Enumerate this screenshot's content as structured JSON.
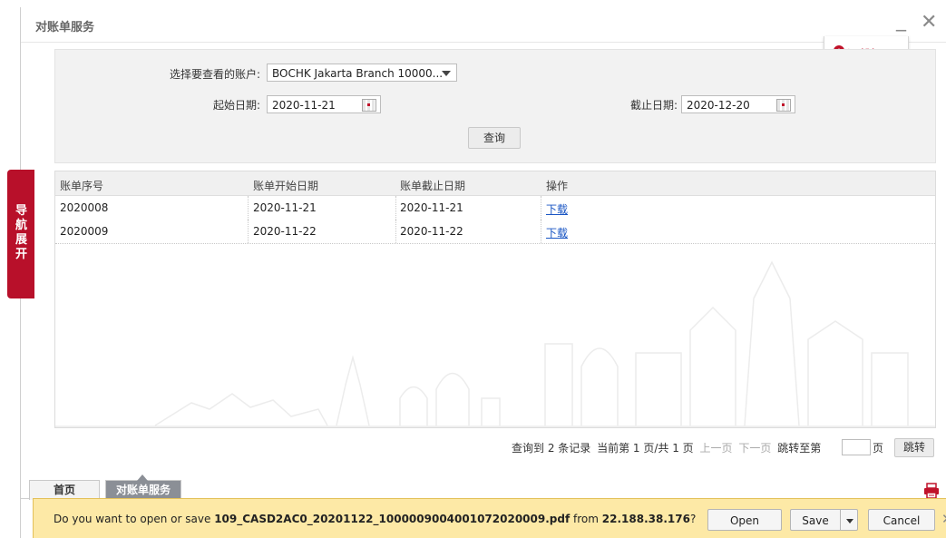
{
  "window": {
    "title": "对账单服务"
  },
  "tips": {
    "label": "温馨提示"
  },
  "nav_tab": {
    "label": "导航展开"
  },
  "query": {
    "account_label": "选择要查看的账户:",
    "account_value": "BOCHK Jakarta Branch 10000...",
    "start_label": "起始日期:",
    "start_value": "2020-11-21",
    "end_label": "截止日期:",
    "end_value": "2020-12-20",
    "search_button": "查询"
  },
  "table": {
    "headers": [
      "账单序号",
      "账单开始日期",
      "账单截止日期",
      "操作"
    ],
    "rows": [
      {
        "id": "2020008",
        "start": "2020-11-21",
        "end": "2020-11-21",
        "action": "下载"
      },
      {
        "id": "2020009",
        "start": "2020-11-22",
        "end": "2020-11-22",
        "action": "下载"
      }
    ]
  },
  "pager": {
    "summary": "查询到 2 条记录",
    "current": "当前第 1 页/共 1 页",
    "prev": "上一页",
    "next": "下一页",
    "jump_label": "跳转至第",
    "page_unit": "页",
    "jump_button": "跳转"
  },
  "tabs": {
    "home": "首页",
    "active": "对账单服务"
  },
  "download_bar": {
    "prefix": "Do you want to open or save",
    "filename": "109_CASD2AC0_20201122_1000009004001072020009.pdf",
    "from": "from",
    "host": "22.188.38.176",
    "suffix": "?",
    "open": "Open",
    "save": "Save",
    "cancel": "Cancel"
  },
  "colors": {
    "brand_red": "#b8102a",
    "link_blue": "#1a56c4",
    "download_bar": "#fde9a6"
  }
}
